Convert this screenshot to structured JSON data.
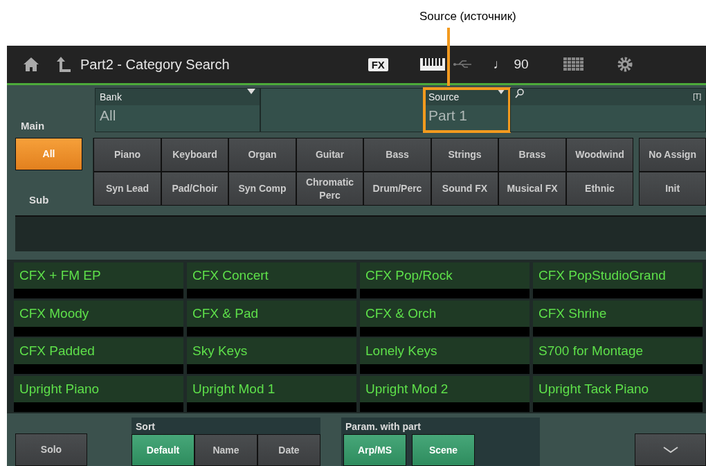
{
  "annotation": {
    "label": "Source (источник)"
  },
  "header": {
    "title": "Part2 - Category Search",
    "fx": "FX",
    "tempo_glyph": "♩",
    "tempo": "90"
  },
  "fields": [
    {
      "kind": "bank",
      "label": "Bank",
      "value": "All",
      "highlighted": false
    },
    {
      "kind": "source",
      "label": "Source",
      "value": "Part 1",
      "highlighted": true
    },
    {
      "kind": "search",
      "label": "[T]"
    }
  ],
  "main_label": "Main",
  "sub_label": "Sub",
  "main_all": {
    "label": "All",
    "selected": true
  },
  "main_categories": [
    {
      "label": "Piano",
      "selected": false
    },
    {
      "label": "Keyboard",
      "selected": false
    },
    {
      "label": "Organ",
      "selected": false
    },
    {
      "label": "Guitar",
      "selected": false
    },
    {
      "label": "Bass",
      "selected": false
    },
    {
      "label": "Strings",
      "selected": false
    },
    {
      "label": "Brass",
      "selected": false
    },
    {
      "label": "Woodwind",
      "selected": false
    },
    {
      "label": "Syn Lead",
      "selected": false
    },
    {
      "label": "Pad/Choir",
      "selected": false
    },
    {
      "label": "Syn Comp",
      "selected": false
    },
    {
      "label": "Chromatic Perc",
      "selected": false
    },
    {
      "label": "Drum/Perc",
      "selected": false
    },
    {
      "label": "Sound FX",
      "selected": false
    },
    {
      "label": "Musical FX",
      "selected": false
    },
    {
      "label": "Ethnic",
      "selected": false
    }
  ],
  "side_buttons": [
    {
      "label": "No Assign",
      "selected": false
    },
    {
      "label": "Init",
      "selected": false
    }
  ],
  "results": [
    "CFX + FM EP",
    "CFX Concert",
    "CFX Pop/Rock",
    "CFX PopStudioGrand",
    "CFX Moody",
    "CFX & Pad",
    "CFX & Orch",
    "CFX Shrine",
    "CFX Padded",
    "Sky Keys",
    "Lonely Keys",
    "S700 for Montage",
    "Upright Piano",
    "Upright Mod 1",
    "Upright Mod 2",
    "Upright Tack Piano"
  ],
  "bottom": {
    "solo": {
      "label": "Solo",
      "on": false
    },
    "sort": {
      "label": "Sort",
      "options": [
        {
          "label": "Default",
          "selected": true
        },
        {
          "label": "Name",
          "selected": false
        },
        {
          "label": "Date",
          "selected": false
        }
      ]
    },
    "param": {
      "label": "Param. with part",
      "options": [
        {
          "label": "Arp/MS",
          "on": true
        },
        {
          "label": "Scene",
          "on": true
        }
      ]
    }
  }
}
